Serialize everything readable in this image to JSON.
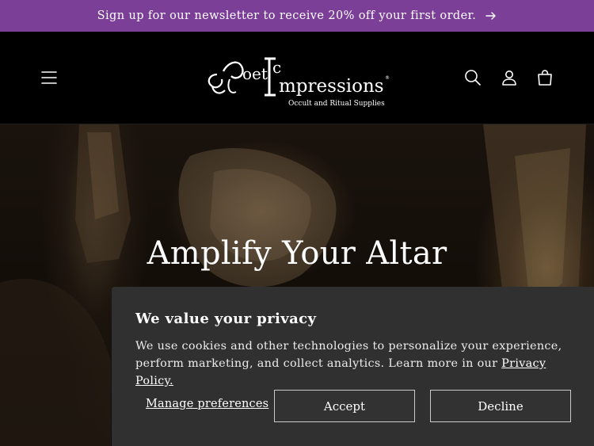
{
  "announcement": {
    "text": "Sign up for our newsletter to receive 20% off your first order.",
    "arrow_icon": "arrow-right-icon"
  },
  "header": {
    "logo": {
      "brand": "Goetic Impressions",
      "registered": "®",
      "tagline": "Occult and Ritual Supplies"
    },
    "icons": [
      "menu-icon",
      "search-icon",
      "account-icon",
      "cart-icon"
    ]
  },
  "hero": {
    "title": "Amplify Your Altar"
  },
  "cookie_banner": {
    "title": "We value your privacy",
    "body": "We use cookies and other technologies to personalize your experience, perform marketing, and collect analytics. Learn more in our",
    "policy_link": "Privacy Policy.",
    "manage_label": "Manage preferences",
    "accept_label": "Accept",
    "decline_label": "Decline",
    "background": "#303030"
  },
  "colors": {
    "announcement_bg": "#7b3f98",
    "header_bg": "#000000"
  }
}
